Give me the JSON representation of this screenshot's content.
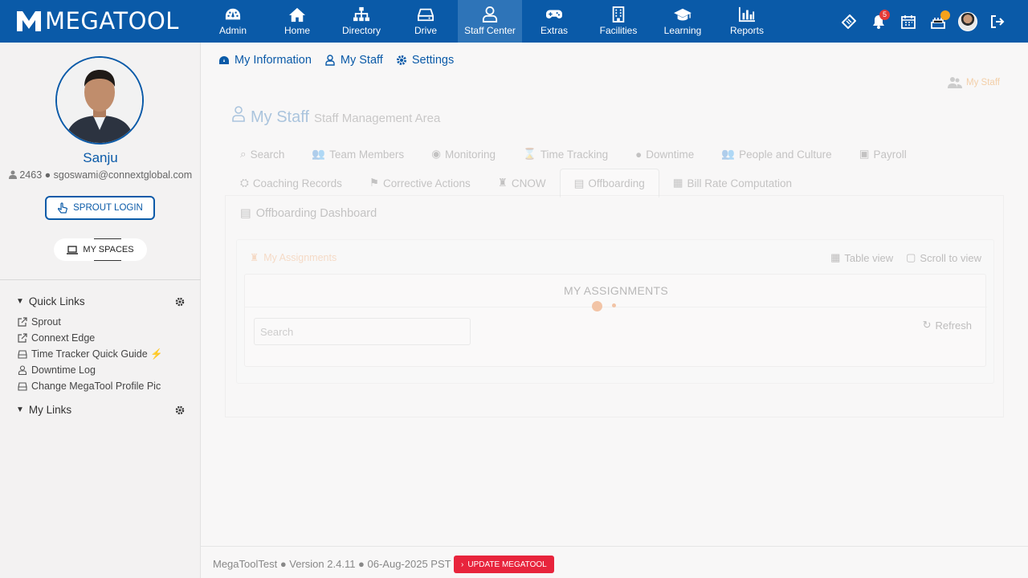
{
  "brand": {
    "name": "MEGATOOL",
    "logo_letter": "M"
  },
  "nav": [
    {
      "label": "Admin",
      "icon": "dashboard-icon"
    },
    {
      "label": "Home",
      "icon": "home-icon"
    },
    {
      "label": "Directory",
      "icon": "sitemap-icon"
    },
    {
      "label": "Drive",
      "icon": "drive-icon"
    },
    {
      "label": "Staff Center",
      "icon": "user-icon",
      "active": true
    },
    {
      "label": "Extras",
      "icon": "gamepad-icon"
    },
    {
      "label": "Facilities",
      "icon": "building-icon"
    },
    {
      "label": "Learning",
      "icon": "graduation-cap-icon"
    },
    {
      "label": "Reports",
      "icon": "bar-chart-icon"
    }
  ],
  "header_icons": {
    "notifications_count": "5"
  },
  "profile": {
    "name": "Sanju",
    "meta": "2463 ● sgoswami@connextglobal.com",
    "sprout_login": "SPROUT LOGIN",
    "my_spaces": "MY SPACES"
  },
  "quick_links": {
    "title": "Quick Links",
    "items": [
      {
        "label": "Sprout"
      },
      {
        "label": "Connext Edge"
      },
      {
        "label": "Time Tracker Quick Guide ⚡"
      },
      {
        "label": "Downtime Log"
      },
      {
        "label": "Change MegaTool Profile Pic"
      }
    ]
  },
  "my_links": {
    "title": "My Links"
  },
  "top_tabs": [
    "My Information",
    "My Staff",
    "Settings"
  ],
  "breadcrumb": "My Staff",
  "page": {
    "title": "My Staff",
    "subtitle": "Staff Management Area"
  },
  "inner_tabs_row1": [
    "Search",
    "Team Members",
    "Monitoring",
    "Time Tracking",
    "Downtime",
    "People and Culture",
    "Payroll"
  ],
  "inner_tabs_row2": [
    "Coaching Records",
    "Corrective Actions",
    "CNOW",
    "Offboarding",
    "Bill Rate Computation"
  ],
  "panel": {
    "title": "Offboarding Dashboard",
    "card_title": "My Assignments",
    "table_view": "Table view",
    "scroll_view": "Scroll to view",
    "inner_title": "MY ASSIGNMENTS",
    "search_placeholder": "Search",
    "refresh": "Refresh"
  },
  "footer": {
    "text": "MegaToolTest ● Version 2.4.11 ● 06-Aug-2025 PST",
    "update": "UPDATE MEGATOOL"
  }
}
